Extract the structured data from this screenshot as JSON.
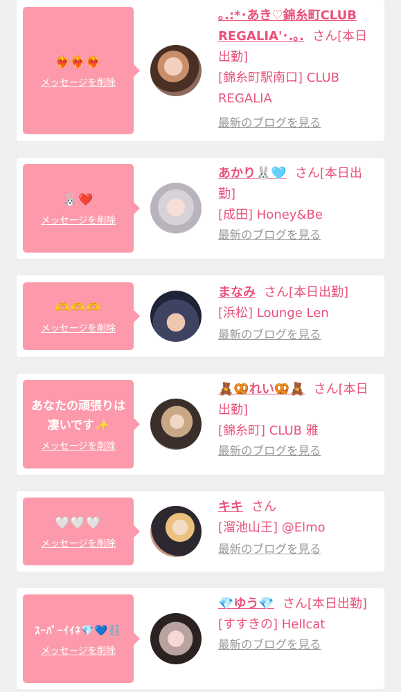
{
  "delete_label": "メッセージを削除",
  "blog_label": "最新のブログを見る",
  "items": [
    {
      "message": "❤️‍🔥❤️‍🔥❤️‍🔥",
      "name": "｡.:*･あき♡錦糸町CLUB REGALIA'･.｡.",
      "suffix": "さん[本日出勤]",
      "shop": "[錦糸町駅南口] CLUB REGALIA"
    },
    {
      "message": "🐰❤️",
      "name": "あかり🐰🩵",
      "suffix": "さん[本日出勤]",
      "shop": "[成田] Honey&Be"
    },
    {
      "message": "🫶🫶🫶",
      "name": "まなみ",
      "suffix": "さん[本日出勤]",
      "shop": "[浜松] Lounge Len"
    },
    {
      "message": "あなたの頑張りは凄いです✨",
      "name": "🧸🥨れい🥨🧸",
      "suffix": "さん[本日出勤]",
      "shop": "[錦糸町] CLUB 雅"
    },
    {
      "message": "🤍🤍🤍",
      "name": "キキ",
      "suffix": "さん",
      "shop": "[溜池山王] @Elmo"
    },
    {
      "message": "ｽｰﾊﾟｰｲｲﾈ💎💙⛓️",
      "name": "💎ゆう💎",
      "suffix": "さん[本日出勤]",
      "shop": "[すすきの] Hellcat"
    }
  ],
  "colors": {
    "background": "#efeff2",
    "bubble": "#fc9aab",
    "accent": "#e9527a",
    "link_gray": "#999999"
  }
}
